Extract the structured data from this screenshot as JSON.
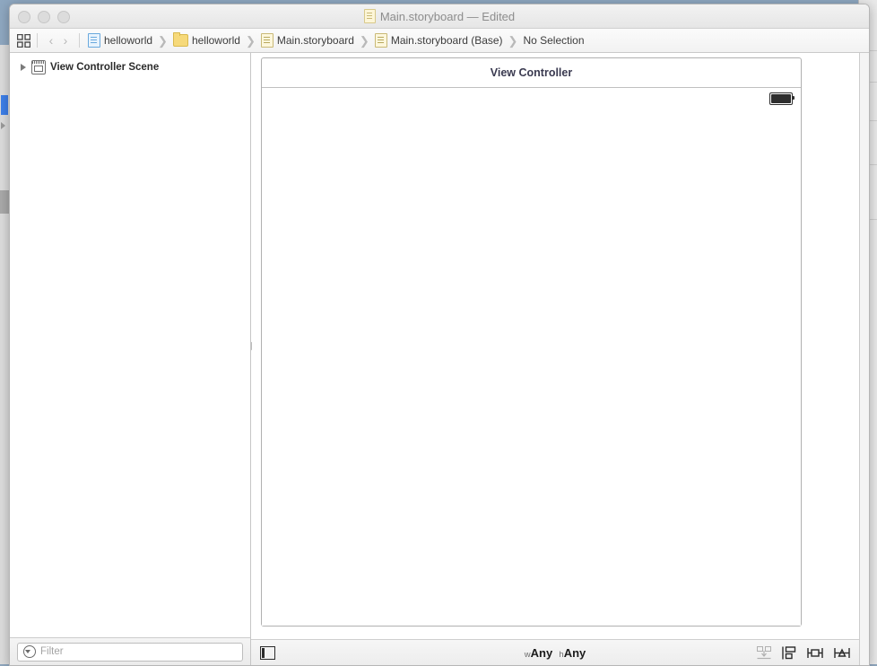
{
  "window": {
    "title": "Main.storyboard — Edited",
    "title_icon": "storyboard-file-icon",
    "traffic_lights": [
      "close",
      "minimize",
      "zoom"
    ]
  },
  "jumpbar": {
    "grid_icon": "related-items-icon",
    "back_label": "‹",
    "forward_label": "›",
    "separator": "❯",
    "crumbs": [
      {
        "label": "helloworld",
        "icon": "project-file-icon"
      },
      {
        "label": "helloworld",
        "icon": "folder-icon"
      },
      {
        "label": "Main.storyboard",
        "icon": "storyboard-file-icon"
      },
      {
        "label": "Main.storyboard (Base)",
        "icon": "storyboard-file-icon"
      },
      {
        "label": "No Selection",
        "icon": "none"
      }
    ]
  },
  "navigator": {
    "tree": [
      {
        "label": "View Controller Scene",
        "icon": "scene-icon",
        "expanded": false
      }
    ],
    "filter": {
      "placeholder": "Filter",
      "value": "",
      "icon": "filter-icon"
    }
  },
  "canvas": {
    "scene": {
      "title": "View Controller",
      "status_bar": {
        "battery_icon": "battery-full-icon"
      }
    },
    "bottombar": {
      "panel_toggle_icon": "document-outline-toggle-icon",
      "size_class": {
        "width_prefix": "w",
        "width_value": "Any",
        "height_prefix": "h",
        "height_value": "Any"
      },
      "autolayout_icons": [
        {
          "name": "update-frames-icon",
          "enabled": false
        },
        {
          "name": "embed-in-stack-icon",
          "enabled": true
        },
        {
          "name": "align-icon",
          "enabled": true
        },
        {
          "name": "pin-icon",
          "enabled": true
        }
      ]
    }
  },
  "colors": {
    "accent": "#3d7fe8",
    "desktop": "#8ea7c0",
    "titlebar": "#f0f0f0",
    "border": "#c6c6c6",
    "scene_title": "#3a3a50",
    "placeholder": "#a3a3a3"
  }
}
